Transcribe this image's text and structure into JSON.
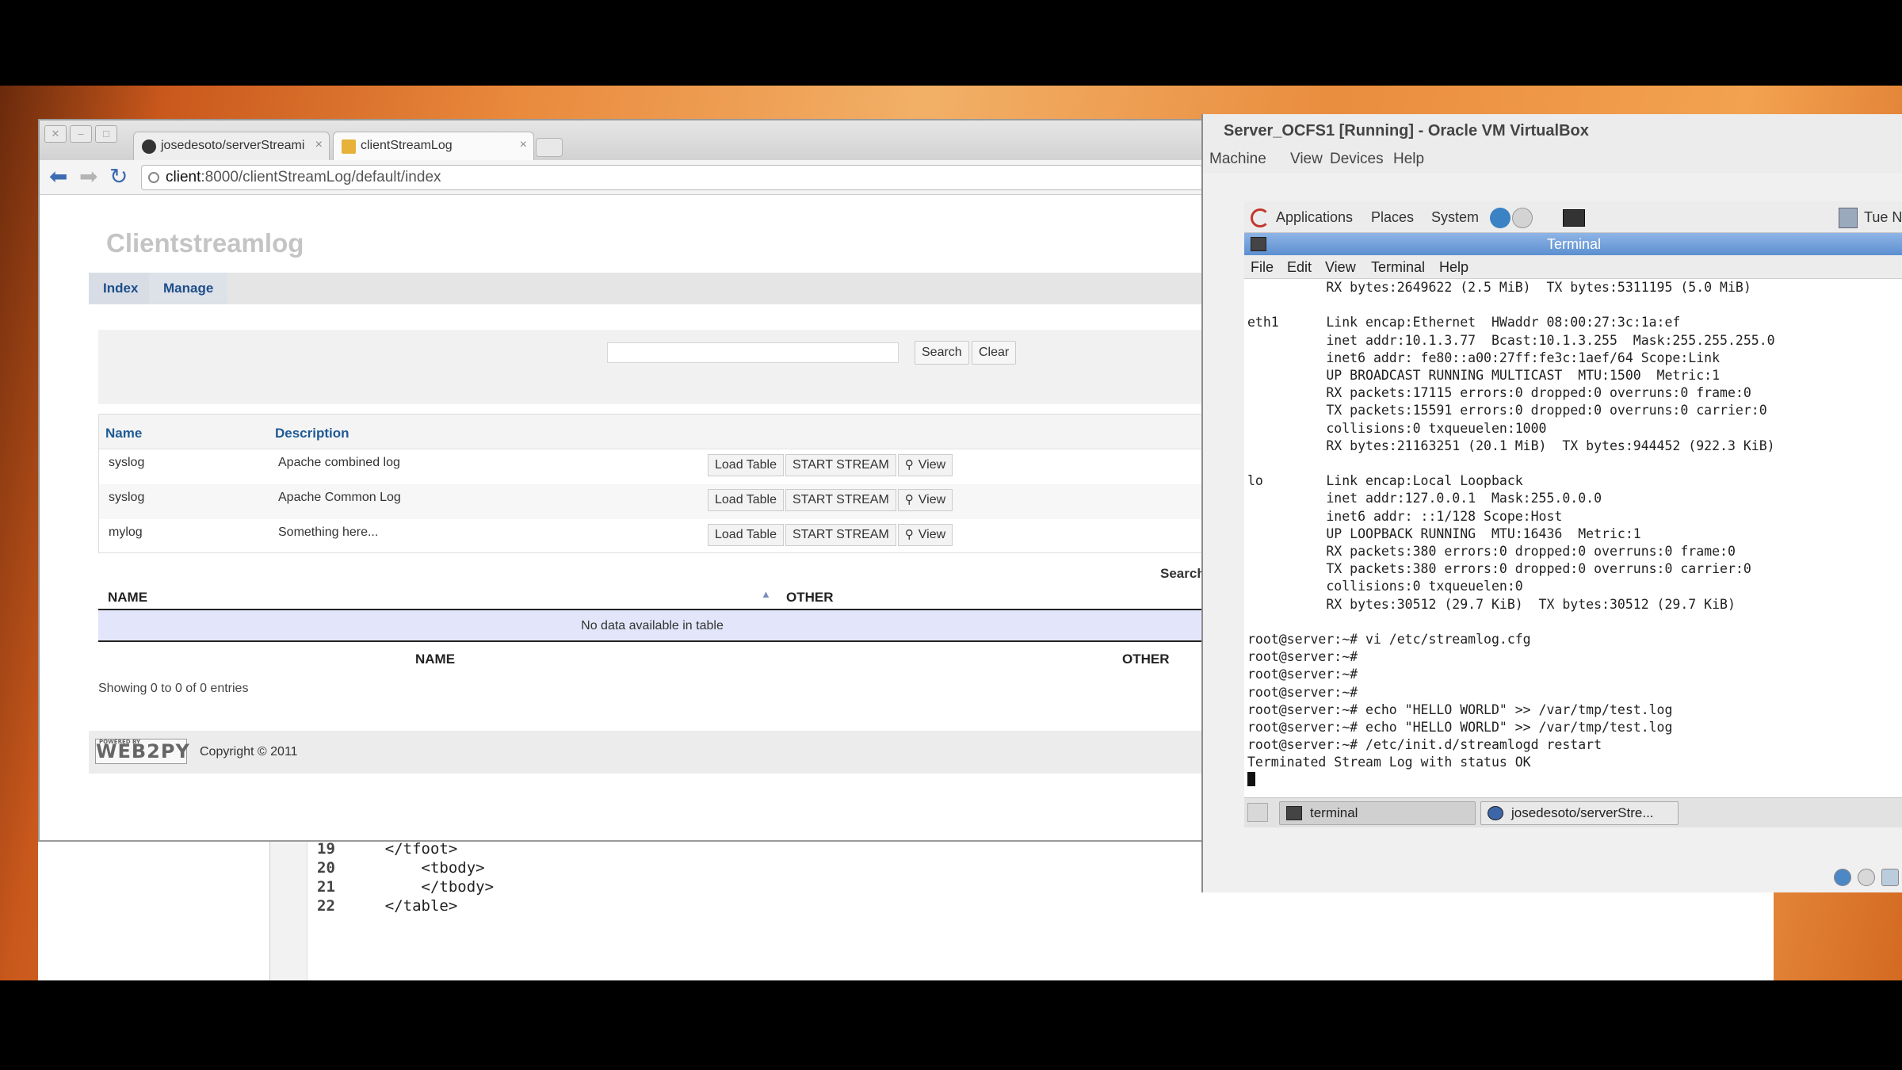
{
  "editor": {
    "lines": [
      {
        "num": "19",
        "code": "    </tfoot>"
      },
      {
        "num": "20",
        "code": "        <tbody>"
      },
      {
        "num": "21",
        "code": "        </tbody>"
      },
      {
        "num": "22",
        "code": "    </table>"
      }
    ]
  },
  "browser": {
    "tabs": [
      {
        "label": "josedesoto/serverStreami"
      },
      {
        "label": "clientStreamLog"
      }
    ],
    "url_host": "client",
    "url_rest": ":8000/clientStreamLog/default/index",
    "site_title": "Clientstreamlog",
    "menu": [
      "Index",
      "Manage"
    ],
    "search_button": "Search",
    "clear_button": "Clear",
    "logs_table": {
      "headers": [
        "Name",
        "Description"
      ],
      "rows": [
        {
          "name": "syslog",
          "description": "Apache combined log"
        },
        {
          "name": "syslog",
          "description": "Apache Common Log"
        },
        {
          "name": "mylog",
          "description": "Something here..."
        }
      ],
      "load_label": "Load Table",
      "stream_label": "START STREAM",
      "view_label": "View"
    },
    "search_label": "Search",
    "datatable": {
      "col_name": "NAME",
      "col_other": "OTHER",
      "empty": "No data available in table",
      "showing": "Showing 0 to 0 of 0 entries"
    },
    "footer_logo": "WEB2PY",
    "footer_logo_small": "POWERED BY",
    "copyright": "Copyright © 2011"
  },
  "vbox": {
    "title": "Server_OCFS1 [Running] - Oracle VM VirtualBox",
    "menu": [
      "Machine",
      "View",
      "Devices",
      "Help"
    ],
    "gnome_panel": {
      "applications": "Applications",
      "places": "Places",
      "system": "System",
      "clock": "Tue N"
    },
    "terminal": {
      "title": "Terminal",
      "menu": [
        "File",
        "Edit",
        "View",
        "Terminal",
        "Help"
      ],
      "lines": [
        "          RX bytes:2649622 (2.5 MiB)  TX bytes:5311195 (5.0 MiB)",
        "",
        "eth1      Link encap:Ethernet  HWaddr 08:00:27:3c:1a:ef",
        "          inet addr:10.1.3.77  Bcast:10.1.3.255  Mask:255.255.255.0",
        "          inet6 addr: fe80::a00:27ff:fe3c:1aef/64 Scope:Link",
        "          UP BROADCAST RUNNING MULTICAST  MTU:1500  Metric:1",
        "          RX packets:17115 errors:0 dropped:0 overruns:0 frame:0",
        "          TX packets:15591 errors:0 dropped:0 overruns:0 carrier:0",
        "          collisions:0 txqueuelen:1000",
        "          RX bytes:21163251 (20.1 MiB)  TX bytes:944452 (922.3 KiB)",
        "",
        "lo        Link encap:Local Loopback",
        "          inet addr:127.0.0.1  Mask:255.0.0.0",
        "          inet6 addr: ::1/128 Scope:Host",
        "          UP LOOPBACK RUNNING  MTU:16436  Metric:1",
        "          RX packets:380 errors:0 dropped:0 overruns:0 frame:0",
        "          TX packets:380 errors:0 dropped:0 overruns:0 carrier:0",
        "          collisions:0 txqueuelen:0",
        "          RX bytes:30512 (29.7 KiB)  TX bytes:30512 (29.7 KiB)",
        "",
        "root@server:~# vi /etc/streamlog.cfg",
        "root@server:~#",
        "root@server:~#",
        "root@server:~#",
        "root@server:~# echo \"HELLO WORLD\" >> /var/tmp/test.log",
        "root@server:~# echo \"HELLO WORLD\" >> /var/tmp/test.log",
        "root@server:~# /etc/init.d/streamlogd restart",
        "Terminated Stream Log with status OK"
      ]
    },
    "taskbar": {
      "terminal": "terminal",
      "chrome": "josedesoto/serverStre..."
    }
  }
}
